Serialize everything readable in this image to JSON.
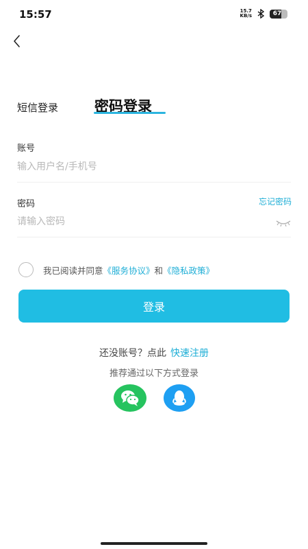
{
  "status_bar": {
    "time": "15:57",
    "net_speed_value": "15.7",
    "net_speed_unit": "KB/s",
    "battery_level": "67",
    "bluetooth_icon": "bluetooth-icon"
  },
  "header": {
    "back_icon": "back-arrow-icon"
  },
  "tabs": {
    "sms_label": "短信登录",
    "password_label": "密码登录",
    "active": "password"
  },
  "account": {
    "label": "账号",
    "placeholder": "输入用户名/手机号",
    "value": ""
  },
  "password": {
    "label": "密码",
    "placeholder": "请输入密码",
    "value": "",
    "forgot_label": "忘记密码",
    "visibility_icon": "eye-closed-icon"
  },
  "agreement": {
    "prefix": "我已阅读并同意",
    "service_link": "《服务协议》",
    "and_text": "和",
    "privacy_link": "《隐私政策》",
    "checked": false
  },
  "login_button": {
    "label": "登录"
  },
  "register": {
    "prompt": "还没账号？点此",
    "link": "快速注册"
  },
  "social": {
    "hint": "推荐通过以下方式登录",
    "providers": [
      {
        "name": "wechat",
        "icon": "wechat-icon",
        "color": "#26c35f"
      },
      {
        "name": "qq",
        "icon": "qq-icon",
        "color": "#1e9ff2"
      }
    ]
  },
  "colors": {
    "accent": "#20bde3",
    "link": "#1eaed6"
  }
}
